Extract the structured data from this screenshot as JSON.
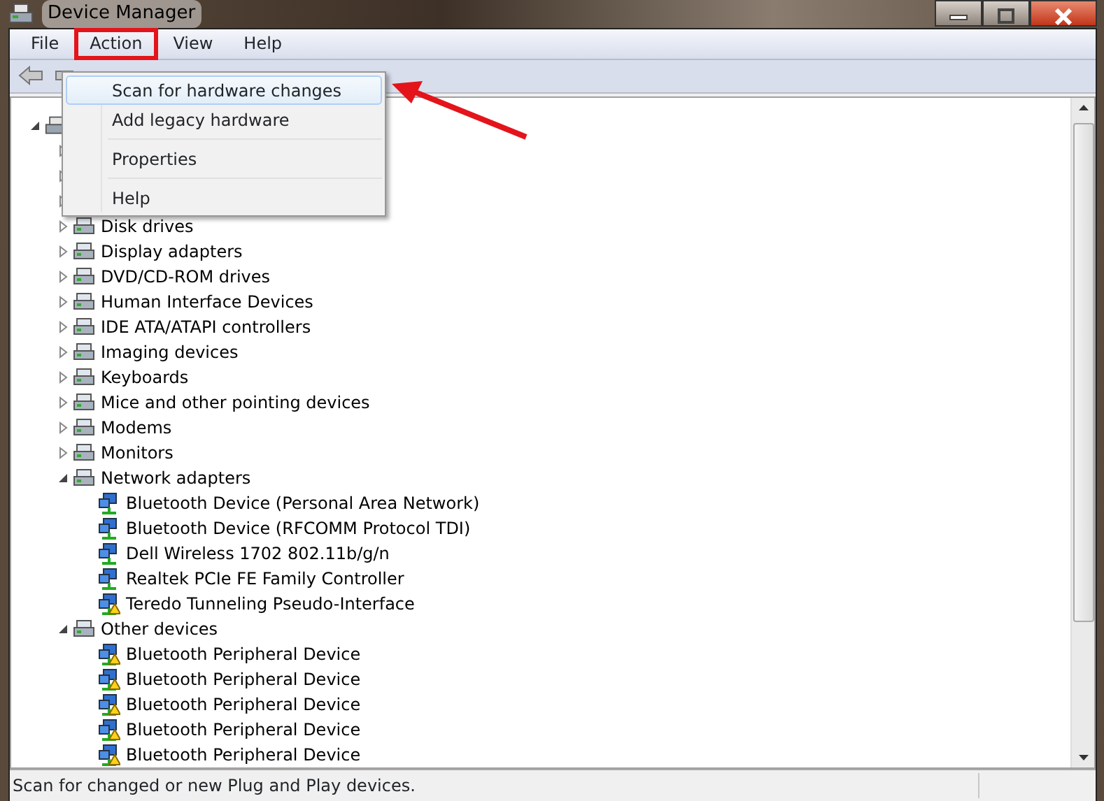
{
  "window": {
    "title": "Device Manager"
  },
  "menubar": [
    {
      "label": "File",
      "selected": false
    },
    {
      "label": "Action",
      "selected": true
    },
    {
      "label": "View",
      "selected": false
    },
    {
      "label": "Help",
      "selected": false
    }
  ],
  "menu": [
    {
      "kind": "item",
      "label": "Scan for hardware changes",
      "highlighted": true
    },
    {
      "kind": "item",
      "label": "Add legacy hardware",
      "highlighted": false
    },
    {
      "kind": "separator"
    },
    {
      "kind": "item",
      "label": "Properties",
      "highlighted": false
    },
    {
      "kind": "separator"
    },
    {
      "kind": "item",
      "label": "Help",
      "highlighted": false
    }
  ],
  "tree": {
    "expanded": true,
    "children": [
      {
        "expanded": false
      },
      {
        "expanded": false
      },
      {
        "expanded": false
      },
      {
        "label": "Disk drives",
        "expanded": false
      },
      {
        "label": "Display adapters",
        "expanded": false
      },
      {
        "label": "DVD/CD-ROM drives",
        "expanded": false
      },
      {
        "label": "Human Interface Devices",
        "expanded": false
      },
      {
        "label": "IDE ATA/ATAPI controllers",
        "expanded": false
      },
      {
        "label": "Imaging devices",
        "expanded": false
      },
      {
        "label": "Keyboards",
        "expanded": false
      },
      {
        "label": "Mice and other pointing devices",
        "expanded": false
      },
      {
        "label": "Modems",
        "expanded": false
      },
      {
        "label": "Monitors",
        "expanded": false
      },
      {
        "label": "Network adapters",
        "expanded": true,
        "children": [
          {
            "label": "Bluetooth Device (Personal Area Network)",
            "warning": false
          },
          {
            "label": "Bluetooth Device (RFCOMM Protocol TDI)",
            "warning": false
          },
          {
            "label": "Dell Wireless 1702 802.11b/g/n",
            "warning": false
          },
          {
            "label": "Realtek PCIe FE Family Controller",
            "warning": false
          },
          {
            "label": "Teredo Tunneling Pseudo-Interface",
            "warning": true
          }
        ]
      },
      {
        "label": "Other devices",
        "expanded": true,
        "children": [
          {
            "label": "Bluetooth Peripheral Device",
            "warning": true
          },
          {
            "label": "Bluetooth Peripheral Device",
            "warning": true
          },
          {
            "label": "Bluetooth Peripheral Device",
            "warning": true
          },
          {
            "label": "Bluetooth Peripheral Device",
            "warning": true
          },
          {
            "label": "Bluetooth Peripheral Device",
            "warning": true
          }
        ]
      }
    ]
  },
  "status_bar": "Scan for changed or new Plug and Play devices."
}
